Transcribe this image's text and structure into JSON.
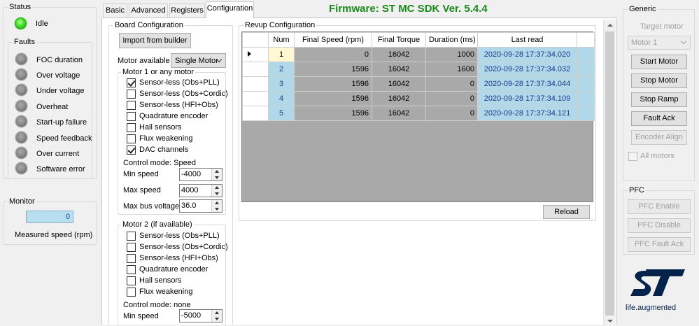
{
  "status": {
    "title": "Status",
    "state_label": "Idle",
    "faults_title": "Faults",
    "faults": [
      "FOC duration",
      "Over voltage",
      "Under voltage",
      "Overheat",
      "Start-up failure",
      "Speed feedback",
      "Over current",
      "Software error"
    ]
  },
  "monitor": {
    "title": "Monitor",
    "value": "0",
    "caption": "Measured speed (rpm)"
  },
  "tabs": [
    "Basic",
    "Advanced",
    "Registers",
    "Configuration"
  ],
  "active_tab": "Configuration",
  "firmware": "Firmware: ST MC SDK Ver. 5.4.4",
  "board": {
    "title": "Board Configuration",
    "import_label": "Import from builder",
    "motor_available_label": "Motor available",
    "motor_available_value": "Single Motor",
    "motor1": {
      "title": "Motor 1 or any motor",
      "options": [
        {
          "label": "Sensor-less (Obs+PLL)",
          "checked": true
        },
        {
          "label": "Sensor-less (Obs+Cordic)",
          "checked": false
        },
        {
          "label": "Sensor-less (HFI+Obs)",
          "checked": false
        },
        {
          "label": "Quadrature encoder",
          "checked": false
        },
        {
          "label": "Hall sensors",
          "checked": false
        },
        {
          "label": "Flux weakening",
          "checked": false
        },
        {
          "label": "DAC channels",
          "checked": true
        }
      ],
      "control_mode": "Control mode: Speed",
      "min_speed_label": "Min speed",
      "min_speed": "-4000",
      "max_speed_label": "Max speed",
      "max_speed": "4000",
      "max_bus_label": "Max bus voltage",
      "max_bus": "36.0"
    },
    "motor2": {
      "title": "Motor 2 (if available)",
      "options": [
        {
          "label": "Sensor-less (Obs+PLL)",
          "checked": false
        },
        {
          "label": "Sensor-less (Obs+Cordic)",
          "checked": false
        },
        {
          "label": "Sensor-less (HFI+Obs)",
          "checked": false
        },
        {
          "label": "Quadrature encoder",
          "checked": false
        },
        {
          "label": "Hall sensors",
          "checked": false
        },
        {
          "label": "Flux weakening",
          "checked": false
        }
      ],
      "control_mode": "Control mode: none",
      "min_speed_label": "Min speed",
      "min_speed": "-5000"
    }
  },
  "revup": {
    "title": "Revup Configuration",
    "columns": [
      "Num",
      "Final Speed (rpm)",
      "Final Torque",
      "Duration (ms)",
      "Last read"
    ],
    "rows": [
      [
        "1",
        "0",
        "16042",
        "1000",
        "2020-09-28 17:37:34.020"
      ],
      [
        "2",
        "1596",
        "16042",
        "1600",
        "2020-09-28 17:37:34.032"
      ],
      [
        "3",
        "1596",
        "16042",
        "0",
        "2020-09-28 17:37:34.044"
      ],
      [
        "4",
        "1596",
        "16042",
        "0",
        "2020-09-28 17:37:34.109"
      ],
      [
        "5",
        "1596",
        "16042",
        "0",
        "2020-09-28 17:37:34.121"
      ]
    ],
    "reload_label": "Reload"
  },
  "generic": {
    "title": "Generic",
    "target_motor_label": "Target motor",
    "target_motor_value": "Motor 1",
    "buttons": [
      "Start Motor",
      "Stop Motor",
      "Stop Ramp",
      "Fault Ack",
      "Encoder Align"
    ],
    "all_motors_label": "All motors"
  },
  "pfc": {
    "title": "PFC",
    "buttons": [
      "PFC Enable",
      "PFC Disable",
      "PFC Fault Ack"
    ]
  },
  "logo": {
    "text": "ST",
    "tagline": "life.augmented",
    "color": "#03234b"
  },
  "colors": {
    "firmware_green": "#1a8a1a",
    "row_blue": "#b0d8e8",
    "grid_empty": "#a9a9a9"
  }
}
